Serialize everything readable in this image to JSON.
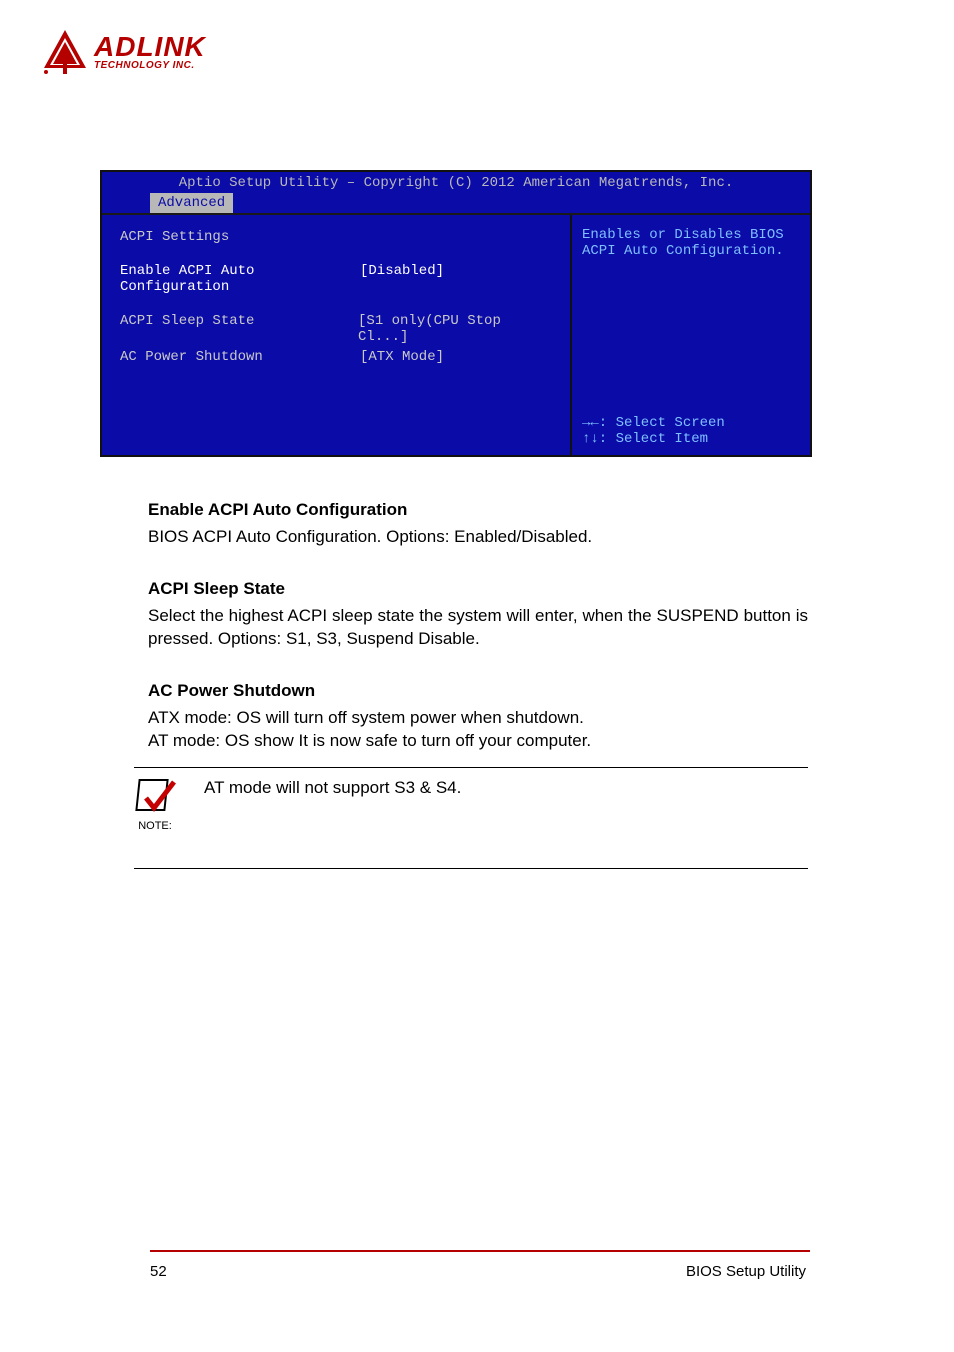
{
  "logo": {
    "title": "ADLINK",
    "subtitle": "TECHNOLOGY INC."
  },
  "bios": {
    "header": "Aptio Setup Utility – Copyright (C) 2012 American Megatrends, Inc.",
    "tab": "Advanced",
    "section_title": "ACPI Settings",
    "rows": [
      {
        "label": "Enable ACPI Auto Configuration",
        "value": "[Disabled]",
        "highlighted": true
      },
      {
        "label": "ACPI Sleep State",
        "value": "[S1 only(CPU Stop Cl...]",
        "highlighted": false
      },
      {
        "label": "AC Power Shutdown",
        "value": "[ATX Mode]",
        "highlighted": false
      }
    ],
    "help": "Enables or Disables BIOS ACPI Auto Configuration.",
    "keys": [
      "→←: Select Screen",
      "↑↓: Select Item"
    ]
  },
  "sections": {
    "s1": {
      "head": "Enable ACPI Auto Configuration",
      "body": "BIOS ACPI Auto Configuration. Options: Enabled/Disabled."
    },
    "s2": {
      "head": "ACPI Sleep State",
      "body": "Select the highest ACPI sleep state the system will enter, when the SUSPEND button is pressed. Options: S1, S3, Suspend Disable."
    },
    "s3": {
      "head": "AC Power Shutdown",
      "body1": "ATX mode: OS will turn off system power when shutdown.",
      "body2": "AT mode: OS show It is now safe to turn off your computer."
    }
  },
  "note": {
    "label": "NOTE:",
    "text": "AT mode will not support S3 & S4."
  },
  "footer": {
    "page": "52",
    "title": "BIOS Setup Utility"
  }
}
